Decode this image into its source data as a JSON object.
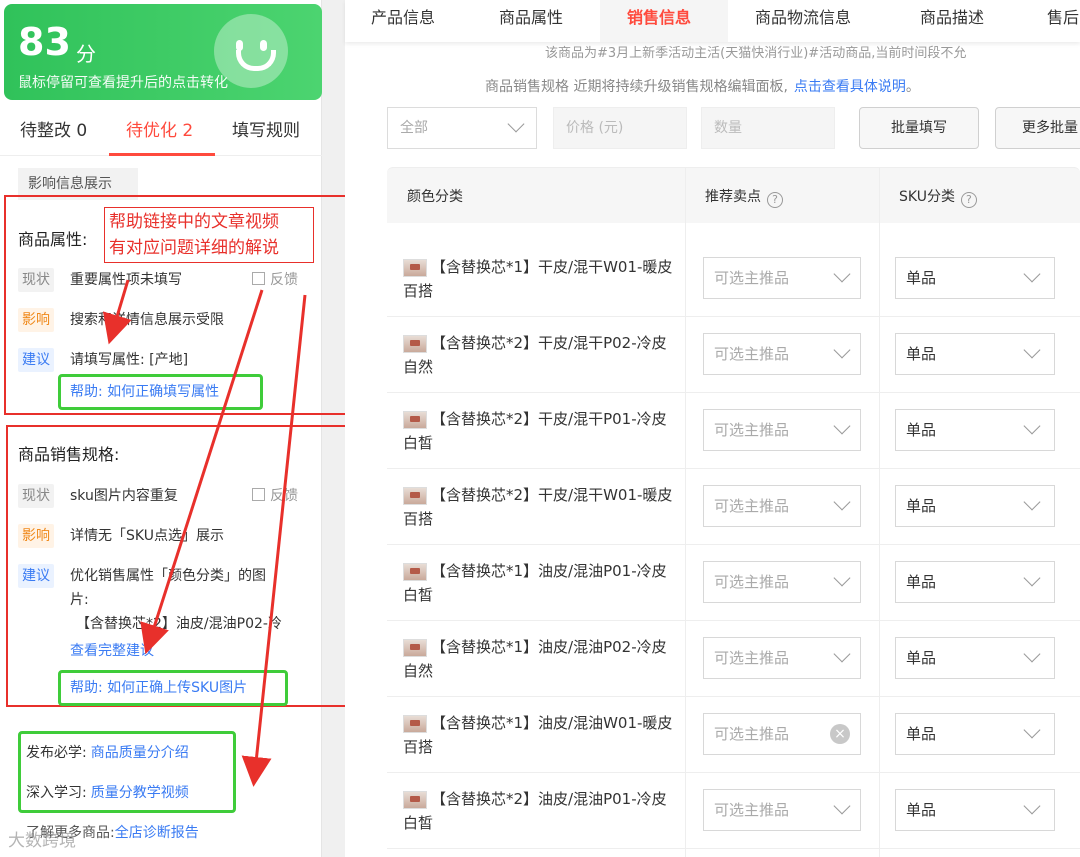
{
  "score_card": {
    "score": "83",
    "unit": "分",
    "hint": "鼠标停留可查看提升后的点击转化"
  },
  "left_tabs": [
    {
      "label": "待整改 0"
    },
    {
      "label": "待优化 2"
    },
    {
      "label": "填写规则"
    }
  ],
  "impact_tag": "影响信息展示",
  "annotation": {
    "line1": "帮助链接中的文章视频",
    "line2": "有对应问题详细的解说"
  },
  "attr_section": {
    "title": "商品属性:",
    "now_tag": "现状",
    "now_text": "重要属性项未填写",
    "feedback": "反馈",
    "impact_tag": "影响",
    "impact_text": "搜索和详情信息展示受限",
    "suggest_tag": "建议",
    "suggest_text": "请填写属性: [产地]",
    "help": "帮助: 如何正确填写属性"
  },
  "sales_section": {
    "title": "商品销售规格:",
    "now_tag": "现状",
    "now_text": "sku图片内容重复",
    "feedback": "反馈",
    "impact_tag": "影响",
    "impact_text": "详情无「SKU点选」展示",
    "suggest_tag": "建议",
    "suggest_text1": "优化销售属性「颜色分类」的图",
    "suggest_text2": "片:",
    "suggest_item": "【含替换芯*2】油皮/混油P02-冷",
    "view_more": "查看完整建议",
    "help": "帮助: 如何正确上传SKU图片"
  },
  "learn": {
    "line1_label": "发布必学:",
    "line1_link": "商品质量分介绍",
    "line2_label": "深入学习:",
    "line2_link": "质量分教学视频",
    "line3_label": "了解更多商品:",
    "line3_link": "全店诊断报告"
  },
  "watermark": "大数跨境",
  "top_tabs": [
    {
      "label": "产品信息"
    },
    {
      "label": "商品属性"
    },
    {
      "label": "销售信息"
    },
    {
      "label": "商品物流信息"
    },
    {
      "label": "商品描述"
    },
    {
      "label": "售后"
    }
  ],
  "clipped_notice": "该商品为#3月上新季活动主活(天猫快消行业)#活动商品,当前时间段不允",
  "spec_info": {
    "text": "商品销售规格  近期将持续升级销售规格编辑面板,",
    "link": "点击查看具体说明",
    "tail": "。"
  },
  "filters": {
    "select": "全部",
    "price_placeholder": "价格 (元)",
    "qty_placeholder": "数量",
    "batch_fill": "批量填写",
    "more_batch": "更多批量"
  },
  "table": {
    "headers": [
      "颜色分类",
      "推荐卖点",
      "SKU分类"
    ],
    "rows": [
      {
        "name": "【含替换芯*1】干皮/混干W01-暖皮百搭",
        "selling": "可选主推品",
        "sku": "单品"
      },
      {
        "name": "【含替换芯*2】干皮/混干P02-冷皮自然",
        "selling": "可选主推品",
        "sku": "单品"
      },
      {
        "name": "【含替换芯*2】干皮/混干P01-冷皮白皙",
        "selling": "可选主推品",
        "sku": "单品"
      },
      {
        "name": "【含替换芯*2】干皮/混干W01-暖皮百搭",
        "selling": "可选主推品",
        "sku": "单品"
      },
      {
        "name": "【含替换芯*1】油皮/混油P01-冷皮白皙",
        "selling": "可选主推品",
        "sku": "单品"
      },
      {
        "name": "【含替换芯*1】油皮/混油P02-冷皮自然",
        "selling": "可选主推品",
        "sku": "单品"
      },
      {
        "name": "【含替换芯*1】油皮/混油W01-暖皮百搭",
        "selling": "可选主推品",
        "sku": "单品"
      },
      {
        "name": "【含替换芯*2】油皮/混油P01-冷皮白皙",
        "selling": "可选主推品",
        "sku": "单品"
      }
    ]
  },
  "colors": {
    "accent": "#ff4a3d",
    "link": "#3a7bf3",
    "score_green": "#30c25a",
    "annotation_red": "#e8302b",
    "annotation_green": "#3fcc3a"
  }
}
